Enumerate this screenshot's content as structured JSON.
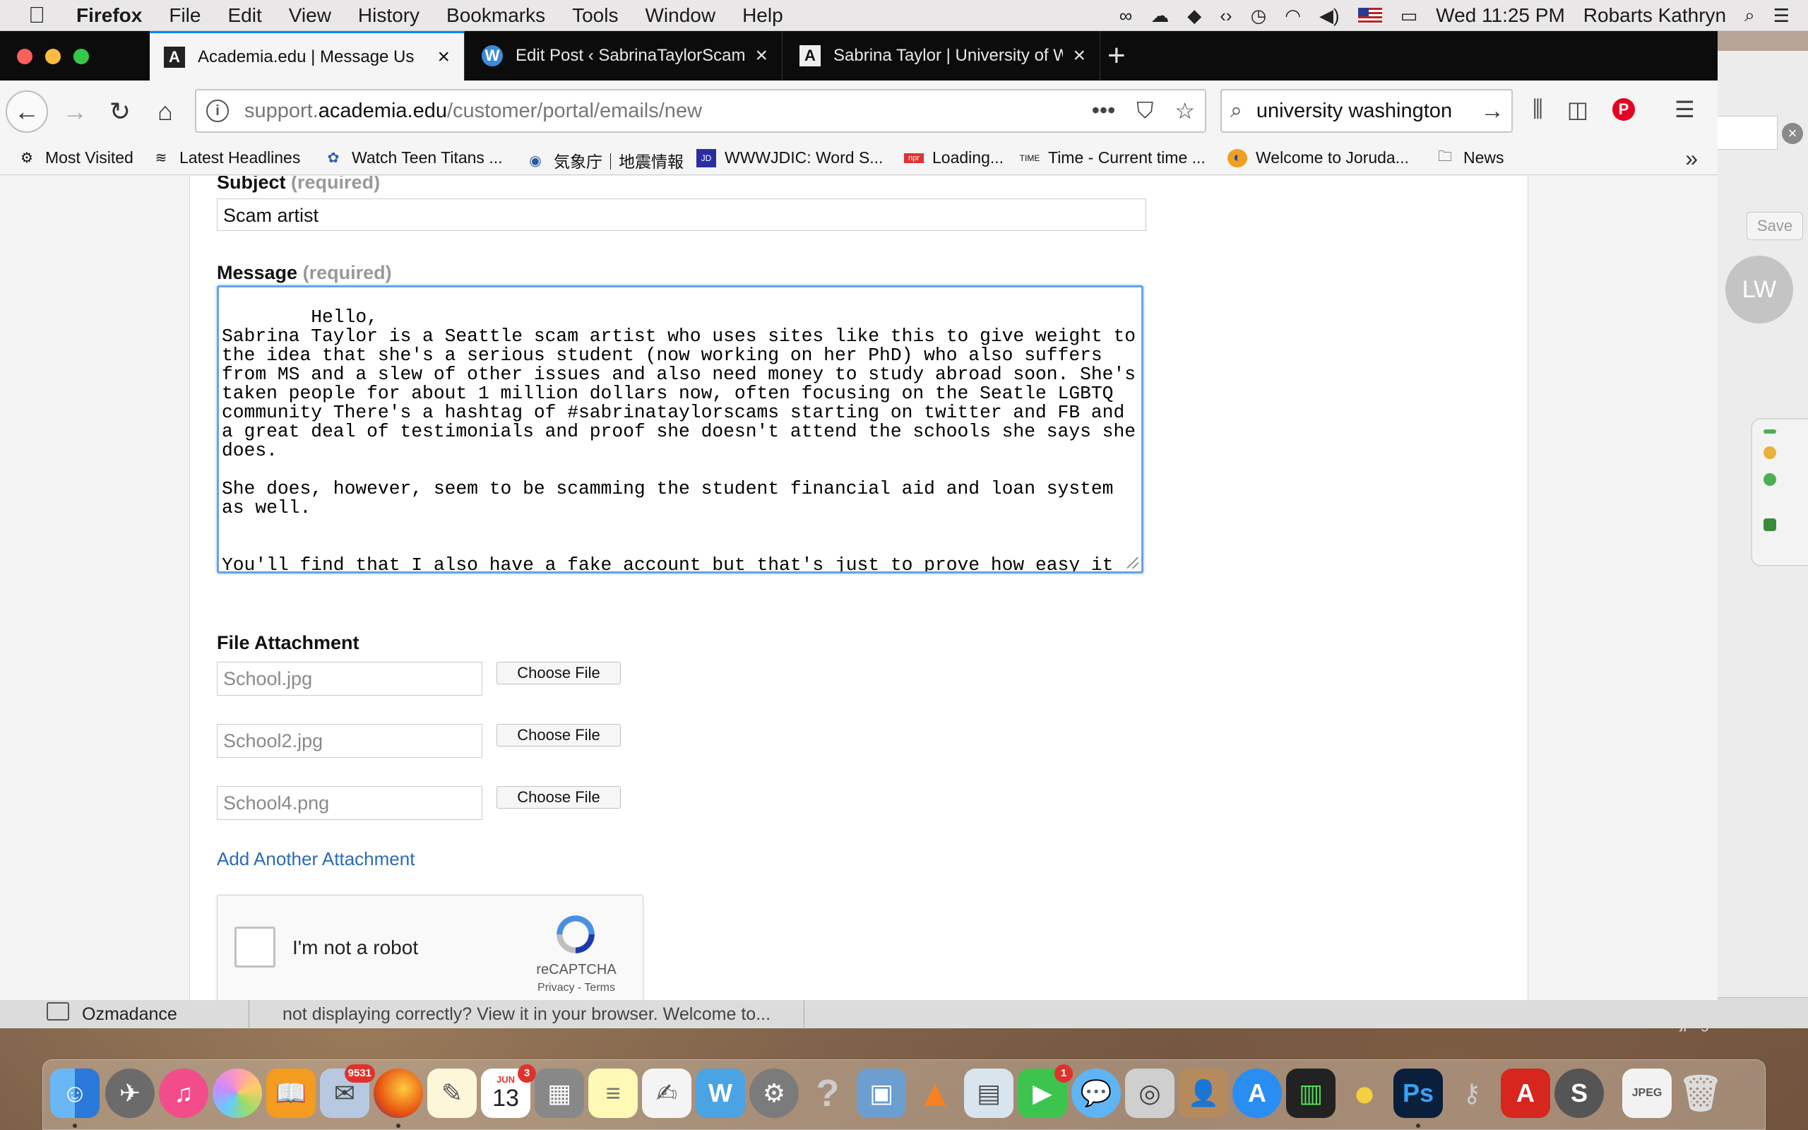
{
  "menubar": {
    "app_name": "Firefox",
    "menus": [
      "File",
      "Edit",
      "View",
      "History",
      "Bookmarks",
      "Tools",
      "Window",
      "Help"
    ],
    "clock": "Wed 11:25 PM",
    "user": "Robarts Kathryn"
  },
  "tabs": [
    {
      "title": "Academia.edu | Message Us",
      "favicon": "A"
    },
    {
      "title": "Edit Post ‹ SabrinaTaylorScams",
      "favicon": "W"
    },
    {
      "title": "Sabrina Taylor | University of W",
      "favicon": "A"
    }
  ],
  "urlbar": {
    "prefix": "support.",
    "domain": "academia.edu",
    "path": "/customer/portal/emails/new"
  },
  "searchbar": {
    "value": "university washington"
  },
  "bookmarks": [
    {
      "label": "Most Visited",
      "icon": "gear-icon"
    },
    {
      "label": "Latest Headlines",
      "icon": "rss-icon"
    },
    {
      "label": "Watch Teen Titans ...",
      "icon": "teen-titans-icon"
    },
    {
      "label": "気象庁｜地震情報",
      "icon": "jma-icon"
    },
    {
      "label": "WWWJDIC: Word S...",
      "icon": "wwwjdic-icon"
    },
    {
      "label": "Loading...",
      "icon": "npr-icon"
    },
    {
      "label": "Time - Current time ...",
      "icon": "time-icon"
    },
    {
      "label": "Welcome to Joruda...",
      "icon": "jorudan-icon"
    },
    {
      "label": "News",
      "icon": "folder-icon"
    }
  ],
  "form": {
    "subject_label": "Subject",
    "subject_req": "(required)",
    "subject_value": "Scam artist",
    "message_label": "Message",
    "message_req": "(required)",
    "message_value": "Hello,\nSabrina Taylor is a Seattle scam artist who uses sites like this to give weight to the idea that she's a serious student (now working on her PhD) who also suffers from MS and a slew of other issues and also need money to study abroad soon. She's taken people for about 1 million dollars now, often focusing on the Seatle LGBTQ community There's a hashtag of #sabrinataylorscams starting on twitter and FB and a great deal of testimonials and proof she doesn't attend the schools she says she does.\n\nShe does, however, seem to be scamming the student financial aid and loan system as well.\n\n\nYou'll find that I also have a fake account but that's just to prove how easy it is...I understand it should be deleted. I Also made it to report the fake profile",
    "attachment_label": "File Attachment",
    "attachments": [
      "School.jpg",
      "School2.jpg",
      "School4.png"
    ],
    "choose_file_label": "Choose File",
    "add_attachment": "Add Another Attachment",
    "captcha_label": "I'm not a robot",
    "captcha_brand": "reCAPTCHA",
    "captcha_links": "Privacy - Terms"
  },
  "background": {
    "save_label": "Save",
    "avatar_initials": "LW",
    "mail_folder": "Ozmadance",
    "mail_preview": "not displaying correctly? View it in your browser. Welcome to...",
    "file_label": "o.jpeg"
  },
  "dock": {
    "mail_badge": "9531",
    "calendar_month": "JUN",
    "calendar_day": "13",
    "calendar_badge": "3",
    "facetime_badge": "1"
  }
}
